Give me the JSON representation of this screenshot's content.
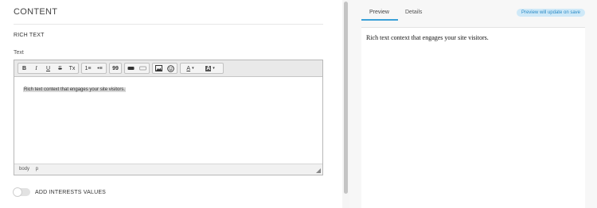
{
  "content": {
    "section_title": "CONTENT",
    "sub_title": "RICH TEXT",
    "field_label": "Text"
  },
  "editor": {
    "toolbar": {
      "bold": "B",
      "italic": "I",
      "underline": "U",
      "strike": "S",
      "clear_format": "Tx",
      "ordered_list": "1≡",
      "bullet_list": "•≡",
      "blockquote": "99",
      "text_color": "A",
      "bg_color": "A"
    },
    "body_text": "Rich text context that engages your site visitors.",
    "status_path": [
      "body",
      "p"
    ]
  },
  "toggle": {
    "label": "ADD INTERESTS VALUES",
    "on": false
  },
  "preview_panel": {
    "tabs": [
      "Preview",
      "Details"
    ],
    "active_tab": "Preview",
    "badge": "Preview will update on save",
    "preview_text": "Rich text context that engages your site visitors."
  },
  "colors": {
    "accent": "#3aa0d8",
    "badge_bg": "#cfe9f8",
    "badge_text": "#2a8ac6"
  }
}
